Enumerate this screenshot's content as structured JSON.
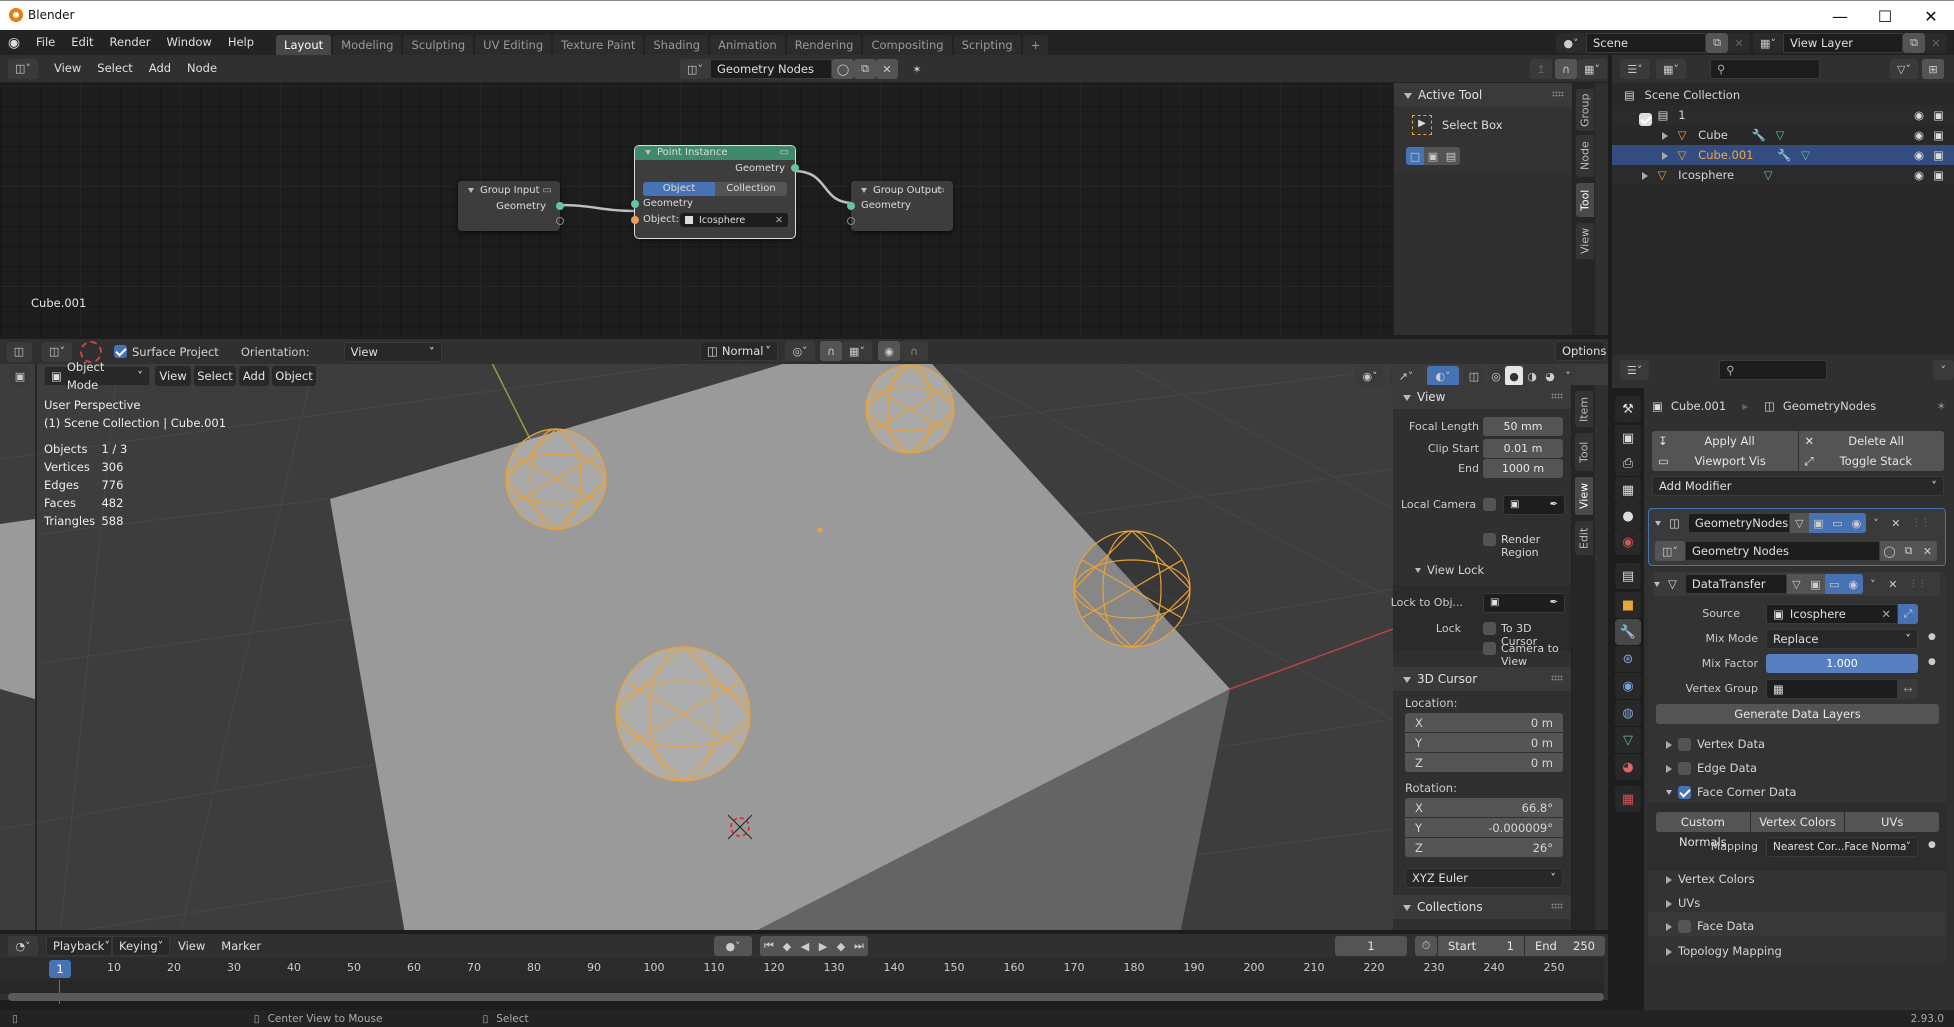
{
  "window": {
    "title": "Blender",
    "controls": [
      "minimize",
      "maximize",
      "close"
    ]
  },
  "topbar": {
    "menus": [
      "File",
      "Edit",
      "Render",
      "Window",
      "Help"
    ],
    "workspaces": [
      "Layout",
      "Modeling",
      "Sculpting",
      "UV Editing",
      "Texture Paint",
      "Shading",
      "Animation",
      "Rendering",
      "Compositing",
      "Scripting"
    ],
    "active_workspace": "Layout",
    "add_workspace": "+",
    "scene": "Scene",
    "view_layer": "View Layer"
  },
  "node_editor": {
    "menus": [
      "View",
      "Select",
      "Add",
      "Node"
    ],
    "node_tree": "Geometry Nodes",
    "object_label": "Cube.001",
    "nodes": {
      "group_input": {
        "title": "Group Input",
        "output": "Geometry"
      },
      "point_instance": {
        "title": "Point Instance",
        "output": "Geometry",
        "mode_options": [
          "Object",
          "Collection"
        ],
        "active_mode": "Object",
        "input_geometry": "Geometry",
        "object_label": "Object:",
        "object_value": "Icosphere"
      },
      "group_output": {
        "title": "Group Output",
        "input": "Geometry"
      }
    },
    "sidebar": {
      "tabs": [
        "Group",
        "Node",
        "Tool",
        "View"
      ],
      "active_tab": "Tool",
      "panel_title": "Active Tool",
      "tool_name": "Select Box"
    }
  },
  "outliner": {
    "root": "Scene Collection",
    "items": [
      {
        "name": "1",
        "type": "collection",
        "checked": true
      },
      {
        "name": "Cube",
        "type": "mesh",
        "modifiers": true
      },
      {
        "name": "Cube.001",
        "type": "mesh",
        "modifiers": true,
        "selected": true
      },
      {
        "name": "Icosphere",
        "type": "mesh",
        "modifiers": false
      }
    ]
  },
  "viewport": {
    "tool_settings": {
      "surface_project_label": "Surface Project",
      "surface_project": true,
      "orientation_label": "Orientation:",
      "orientation": "View",
      "transform_orientation": "Normal",
      "options": "Options"
    },
    "mode": "Object Mode",
    "menus": [
      "View",
      "Select",
      "Add",
      "Object"
    ],
    "overlay": {
      "perspective": "User Perspective",
      "collection": "(1) Scene Collection | Cube.001",
      "stats": [
        {
          "label": "Objects",
          "value": "1 / 3"
        },
        {
          "label": "Vertices",
          "value": "306"
        },
        {
          "label": "Edges",
          "value": "776"
        },
        {
          "label": "Faces",
          "value": "482"
        },
        {
          "label": "Triangles",
          "value": "588"
        }
      ]
    },
    "sidebar": {
      "tabs": [
        "Item",
        "Tool",
        "View",
        "Edit"
      ],
      "active_tab": "View",
      "view_panel": {
        "title": "View",
        "focal_length_label": "Focal Length",
        "focal_length": "50 mm",
        "clip_start_label": "Clip Start",
        "clip_start": "0.01 m",
        "clip_end_label": "End",
        "clip_end": "1000 m",
        "local_camera_label": "Local Camera",
        "render_region_label": "Render Region",
        "view_lock_title": "View Lock",
        "lock_to_object_label": "Lock to Obj...",
        "lock_label": "Lock",
        "to_3d_cursor_label": "To 3D Cursor",
        "camera_to_view_label": "Camera to View"
      },
      "cursor_panel": {
        "title": "3D Cursor",
        "location_label": "Location:",
        "location": [
          {
            "axis": "X",
            "value": "0 m"
          },
          {
            "axis": "Y",
            "value": "0 m"
          },
          {
            "axis": "Z",
            "value": "0 m"
          }
        ],
        "rotation_label": "Rotation:",
        "rotation": [
          {
            "axis": "X",
            "value": "66.8°"
          },
          {
            "axis": "Y",
            "value": "-0.000009°"
          },
          {
            "axis": "Z",
            "value": "26°"
          }
        ],
        "rotation_mode": "XYZ Euler"
      },
      "collections_title": "Collections"
    }
  },
  "properties": {
    "breadcrumb_object": "Cube.001",
    "breadcrumb_modifier": "GeometryNodes",
    "apply_all": "Apply All",
    "delete_all": "Delete All",
    "viewport_vis": "Viewport Vis",
    "toggle_stack": "Toggle Stack",
    "add_modifier": "Add Modifier",
    "modifiers": [
      {
        "name": "GeometryNodes",
        "node_group": "Geometry Nodes"
      },
      {
        "name": "DataTransfer",
        "source_label": "Source",
        "source": "Icosphere",
        "mix_mode_label": "Mix Mode",
        "mix_mode": "Replace",
        "mix_factor_label": "Mix Factor",
        "mix_factor": "1.000",
        "vertex_group_label": "Vertex Group",
        "generate_label": "Generate Data Layers",
        "sections": [
          {
            "label": "Vertex Data",
            "checked": false
          },
          {
            "label": "Edge Data",
            "checked": false
          },
          {
            "label": "Face Corner Data",
            "checked": true
          }
        ],
        "face_corner_types": [
          "Custom Normals",
          "Vertex Colors",
          "UVs"
        ],
        "mapping_label": "Mapping",
        "mapping": "Nearest Cor...Face Normal",
        "subsections": [
          "Vertex Colors",
          "UVs"
        ],
        "face_data_label": "Face Data",
        "topology_label": "Topology Mapping"
      }
    ]
  },
  "timeline": {
    "menus": [
      "Playback",
      "Keying",
      "View",
      "Marker"
    ],
    "current_frame": "1",
    "start_label": "Start",
    "start": "1",
    "end_label": "End",
    "end": "250",
    "ticks": [
      "10",
      "20",
      "30",
      "40",
      "50",
      "60",
      "70",
      "80",
      "90",
      "100",
      "110",
      "120",
      "130",
      "140",
      "150",
      "160",
      "170",
      "180",
      "190",
      "200",
      "210",
      "220",
      "230",
      "240",
      "250"
    ]
  },
  "statusbar": {
    "center_view": "Center View to Mouse",
    "select": "Select",
    "version": "2.93.0"
  }
}
